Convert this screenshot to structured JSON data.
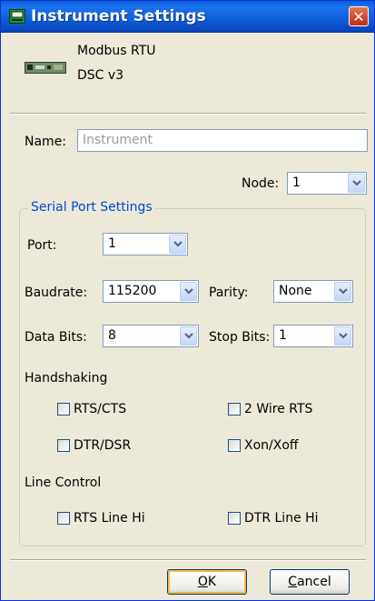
{
  "window": {
    "title": "Instrument Settings",
    "close_symbol": "✕"
  },
  "device": {
    "protocol": "Modbus RTU",
    "model": "DSC v3"
  },
  "name_field": {
    "label": "Name:",
    "placeholder": "Instrument"
  },
  "node": {
    "label": "Node:",
    "value": "1"
  },
  "serial": {
    "group_title": "Serial Port Settings",
    "port": {
      "label": "Port:",
      "value": "1"
    },
    "baudrate": {
      "label": "Baudrate:",
      "value": "115200"
    },
    "parity": {
      "label": "Parity:",
      "value": "None"
    },
    "data_bits": {
      "label": "Data Bits:",
      "value": "8"
    },
    "stop_bits": {
      "label": "Stop Bits:",
      "value": "1"
    },
    "handshaking": {
      "title": "Handshaking",
      "rts_cts": "RTS/CTS",
      "two_wire_rts": "2 Wire RTS",
      "dtr_dsr": "DTR/DSR",
      "xon_xoff": "Xon/Xoff"
    },
    "line_control": {
      "title": "Line Control",
      "rts_line_hi": "RTS Line Hi",
      "dtr_line_hi": "DTR Line Hi"
    }
  },
  "buttons": {
    "ok": {
      "hotkey": "O",
      "rest": "K"
    },
    "cancel": {
      "hotkey": "C",
      "rest": "ancel"
    }
  },
  "colors": {
    "title_bar": "#0a5ed8",
    "group_title": "#0046d5",
    "close_button": "#d2462a"
  },
  "icons": [
    "window-app-icon",
    "device-icon",
    "close-icon",
    "dropdown-arrow-icon"
  ]
}
